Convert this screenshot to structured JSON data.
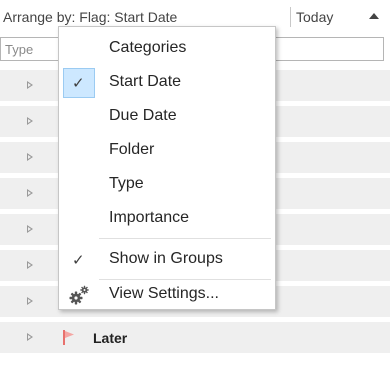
{
  "header": {
    "arrange_label": "Arrange by: Flag: Start Date",
    "today_label": "Today"
  },
  "search": {
    "text": "Type"
  },
  "groups": [
    {
      "label": ""
    },
    {
      "label": ""
    },
    {
      "label": ""
    },
    {
      "label": ""
    },
    {
      "label": ""
    },
    {
      "label": ""
    },
    {
      "label": ""
    },
    {
      "label": "Later",
      "flag_color": "#e8716d"
    }
  ],
  "menu": {
    "items": [
      {
        "label": "Categories",
        "checked": false
      },
      {
        "label": "Start Date",
        "checked": true
      },
      {
        "label": "Due Date",
        "checked": false
      },
      {
        "label": "Folder",
        "checked": false
      },
      {
        "label": "Type",
        "checked": false
      },
      {
        "label": "Importance",
        "checked": false
      },
      {
        "label": "Show in Groups",
        "checked": true
      },
      {
        "label": "View Settings...",
        "icon": "gear-icon"
      }
    ]
  },
  "colors": {
    "highlight": "#cde8ff",
    "flag": "#e8716d",
    "group_bg": "#efefef"
  }
}
